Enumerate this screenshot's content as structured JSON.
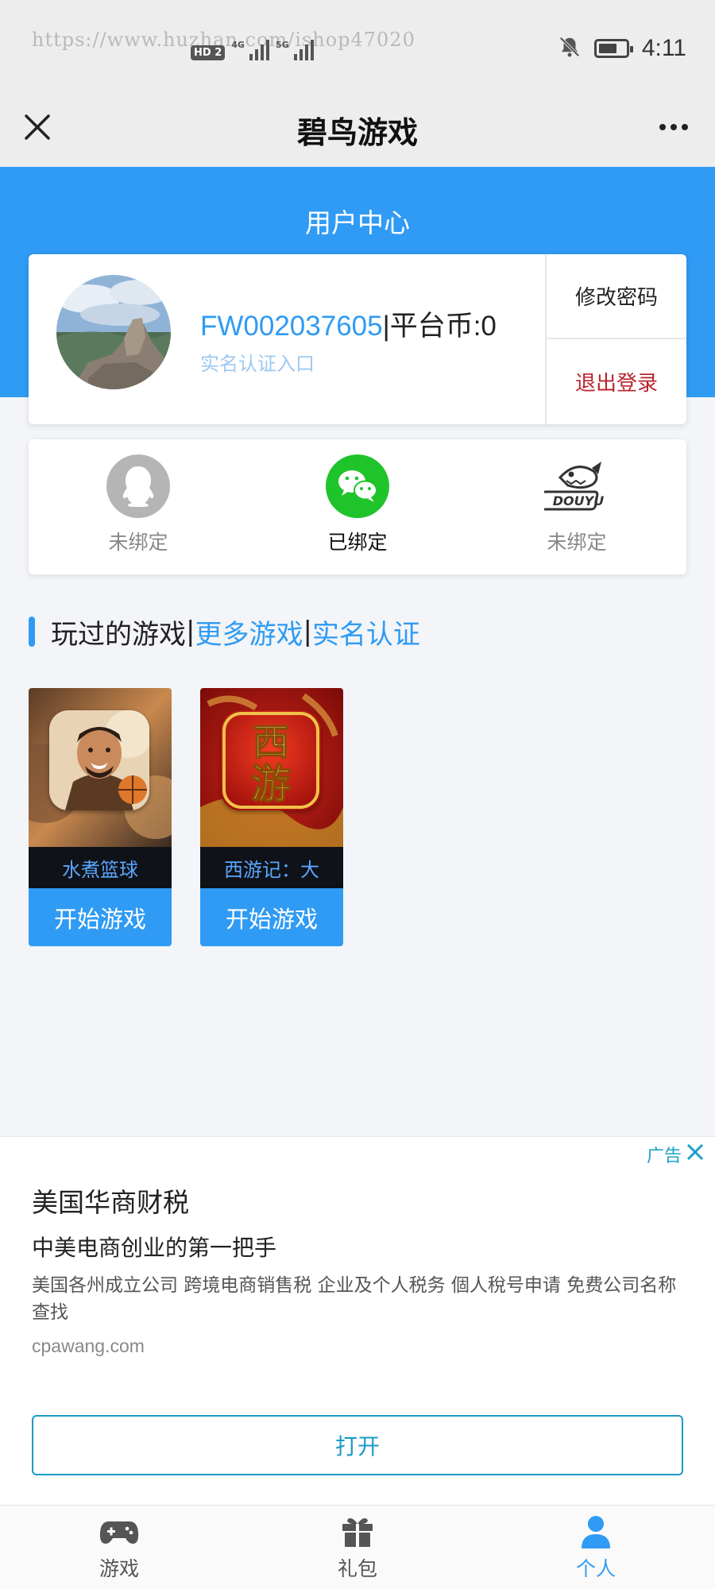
{
  "status_bar": {
    "watermark": "https://www.huzhan.com/ishop47020",
    "hd_badge": "HD",
    "hd_num": "2",
    "signal_1_tag": "4G",
    "signal_2_tag": "5G",
    "time": "4:11",
    "battery_level": 0.7,
    "icons": [
      "mute-bell-icon",
      "battery-icon"
    ]
  },
  "title_bar": {
    "title": "碧鸟游戏",
    "close_icon": "close-icon",
    "more_icon": "more-dots-icon"
  },
  "user_center": {
    "heading": "用户中心",
    "user_id": "FW002037605",
    "separator": "|",
    "coin_text": "平台币:0",
    "realname_link": "实名认证入口",
    "change_password": "修改密码",
    "logout": "退出登录"
  },
  "bindings": [
    {
      "icon": "qq-icon",
      "label": "未绑定",
      "bound": false
    },
    {
      "icon": "wechat-icon",
      "label": "已绑定",
      "bound": true
    },
    {
      "icon": "douyu-icon",
      "label": "未绑定",
      "bound": false
    }
  ],
  "section": {
    "played": "玩过的游戏",
    "sep1": "|",
    "more_games": "更多游戏",
    "sep2": "|",
    "realname": "实名认证"
  },
  "games": [
    {
      "name": "水煮篮球",
      "play": "开始游戏"
    },
    {
      "name": "西游记：大",
      "play": "开始游戏",
      "icon_text_1": "西",
      "icon_text_2": "游"
    }
  ],
  "ad": {
    "tag": "广告",
    "title": "美国华商财税",
    "subtitle": "中美电商创业的第一把手",
    "description": "美国各州成立公司 跨境电商销售税 企业及个人税务 個人稅号申请 免费公司名称查找",
    "url": "cpawang.com",
    "open_button": "打开"
  },
  "bottom_nav": {
    "items": [
      {
        "label": "游戏",
        "icon": "gamepad-icon"
      },
      {
        "label": "礼包",
        "icon": "gift-icon"
      },
      {
        "label": "个人",
        "icon": "person-icon",
        "active": true
      }
    ]
  },
  "colors": {
    "primary": "#2f9bf4",
    "logout_red": "#b9242d",
    "wechat_green": "#1fc32a",
    "ad_teal": "#1a9ac6"
  }
}
